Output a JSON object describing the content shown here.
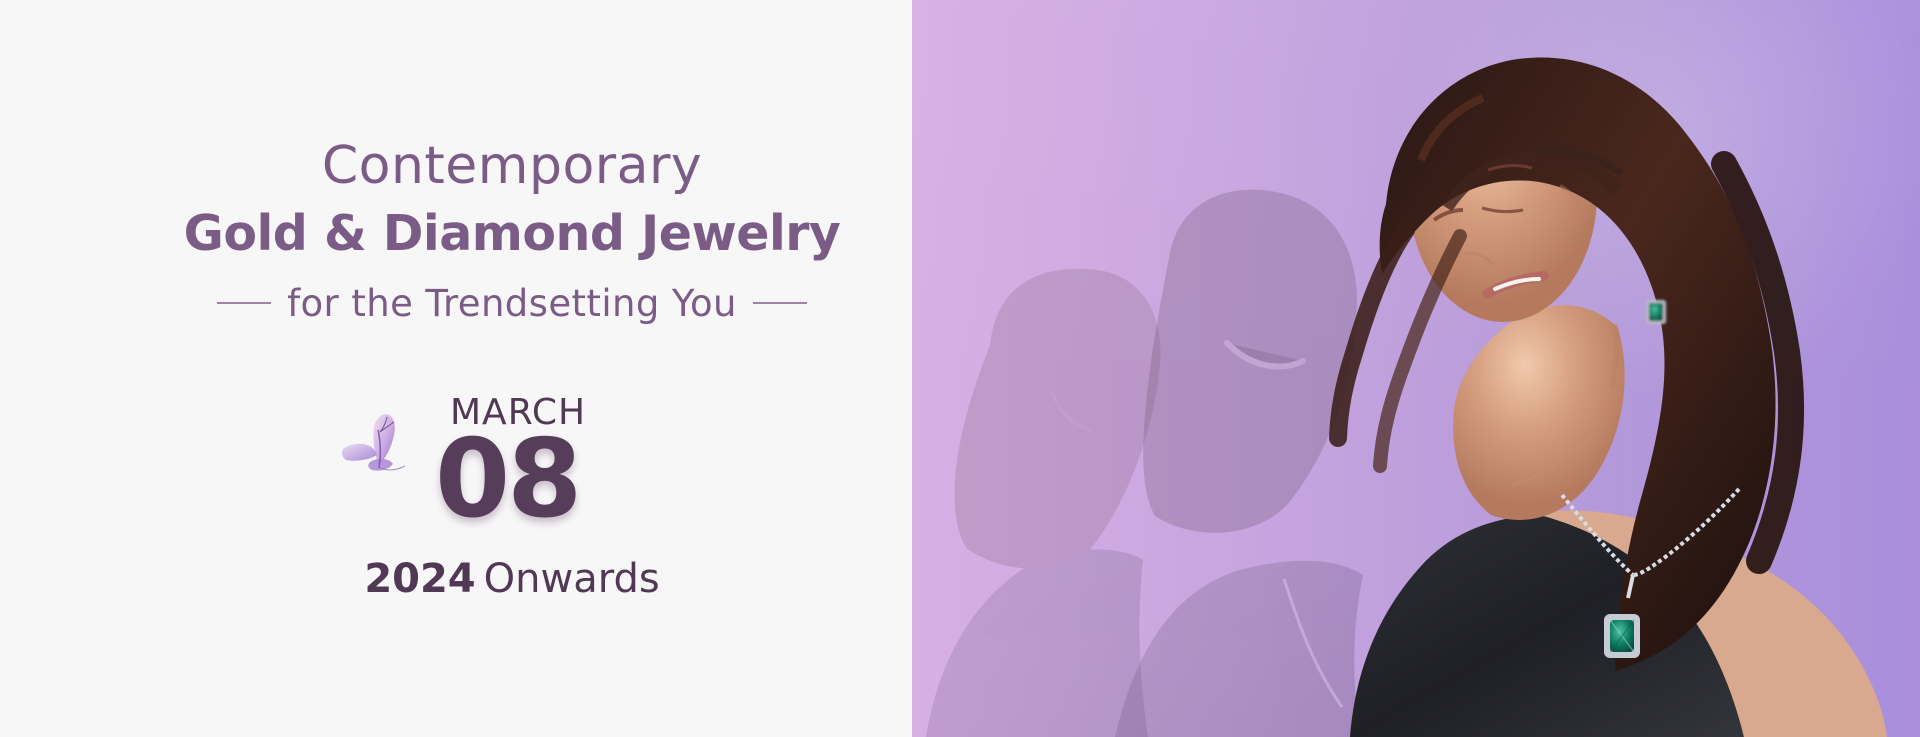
{
  "headline": {
    "line_1": "Contemporary",
    "line_2": "Gold & Diamond Jewelry",
    "tagline": "for the Trendsetting You"
  },
  "launch": {
    "month": "MARCH",
    "day": "08",
    "year": "2024",
    "suffix": "Onwards"
  },
  "colors": {
    "left_background": "#f8f7f8",
    "text_purple": "#7b5c87",
    "date_purple": "#513955",
    "photo_gradient_start": "#d7b0e4",
    "photo_gradient_end": "#a98edc"
  },
  "icons": {
    "decorative_butterfly": "butterfly-icon"
  }
}
